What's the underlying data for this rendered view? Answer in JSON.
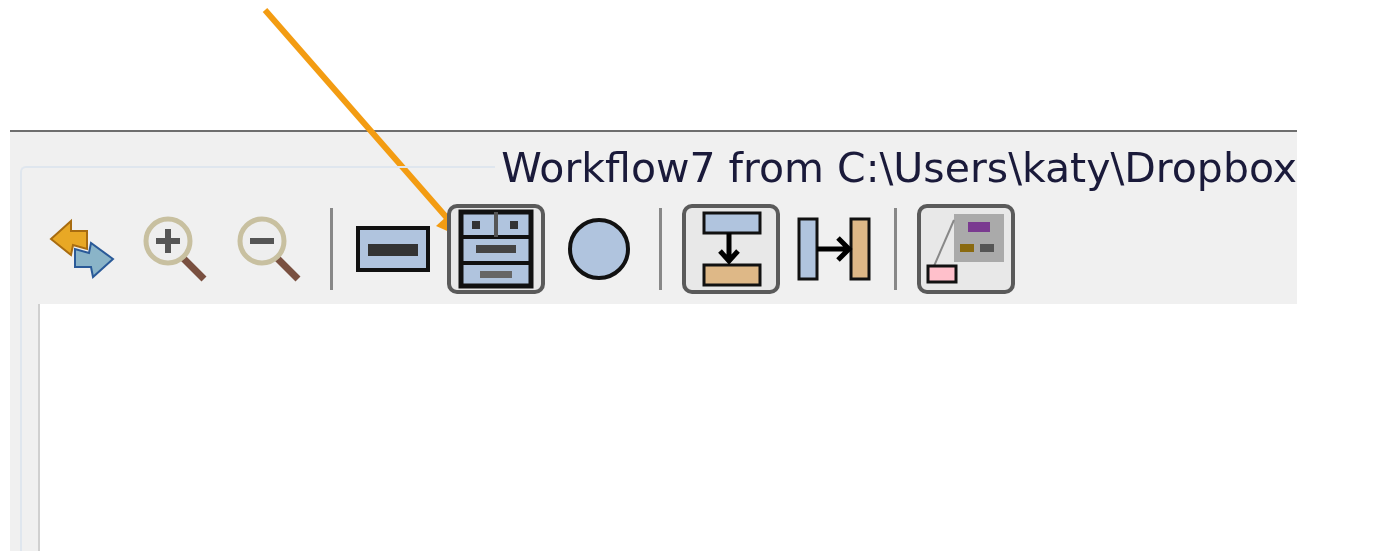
{
  "window": {
    "title": "Workflow7 from C:\\Users\\katy\\Dropbox"
  },
  "toolbar_groups": [
    [
      {
        "kind": "refresh",
        "selected": false
      },
      {
        "kind": "zoom-in",
        "selected": false
      },
      {
        "kind": "zoom-out",
        "selected": false
      }
    ],
    [
      {
        "kind": "text",
        "selected": false
      },
      {
        "kind": "table",
        "selected": true
      },
      {
        "kind": "circle",
        "selected": false
      }
    ],
    [
      {
        "kind": "vertical",
        "selected": true
      },
      {
        "kind": "horizontal",
        "selected": false
      }
    ],
    [
      {
        "kind": "overview",
        "selected": true
      }
    ]
  ]
}
